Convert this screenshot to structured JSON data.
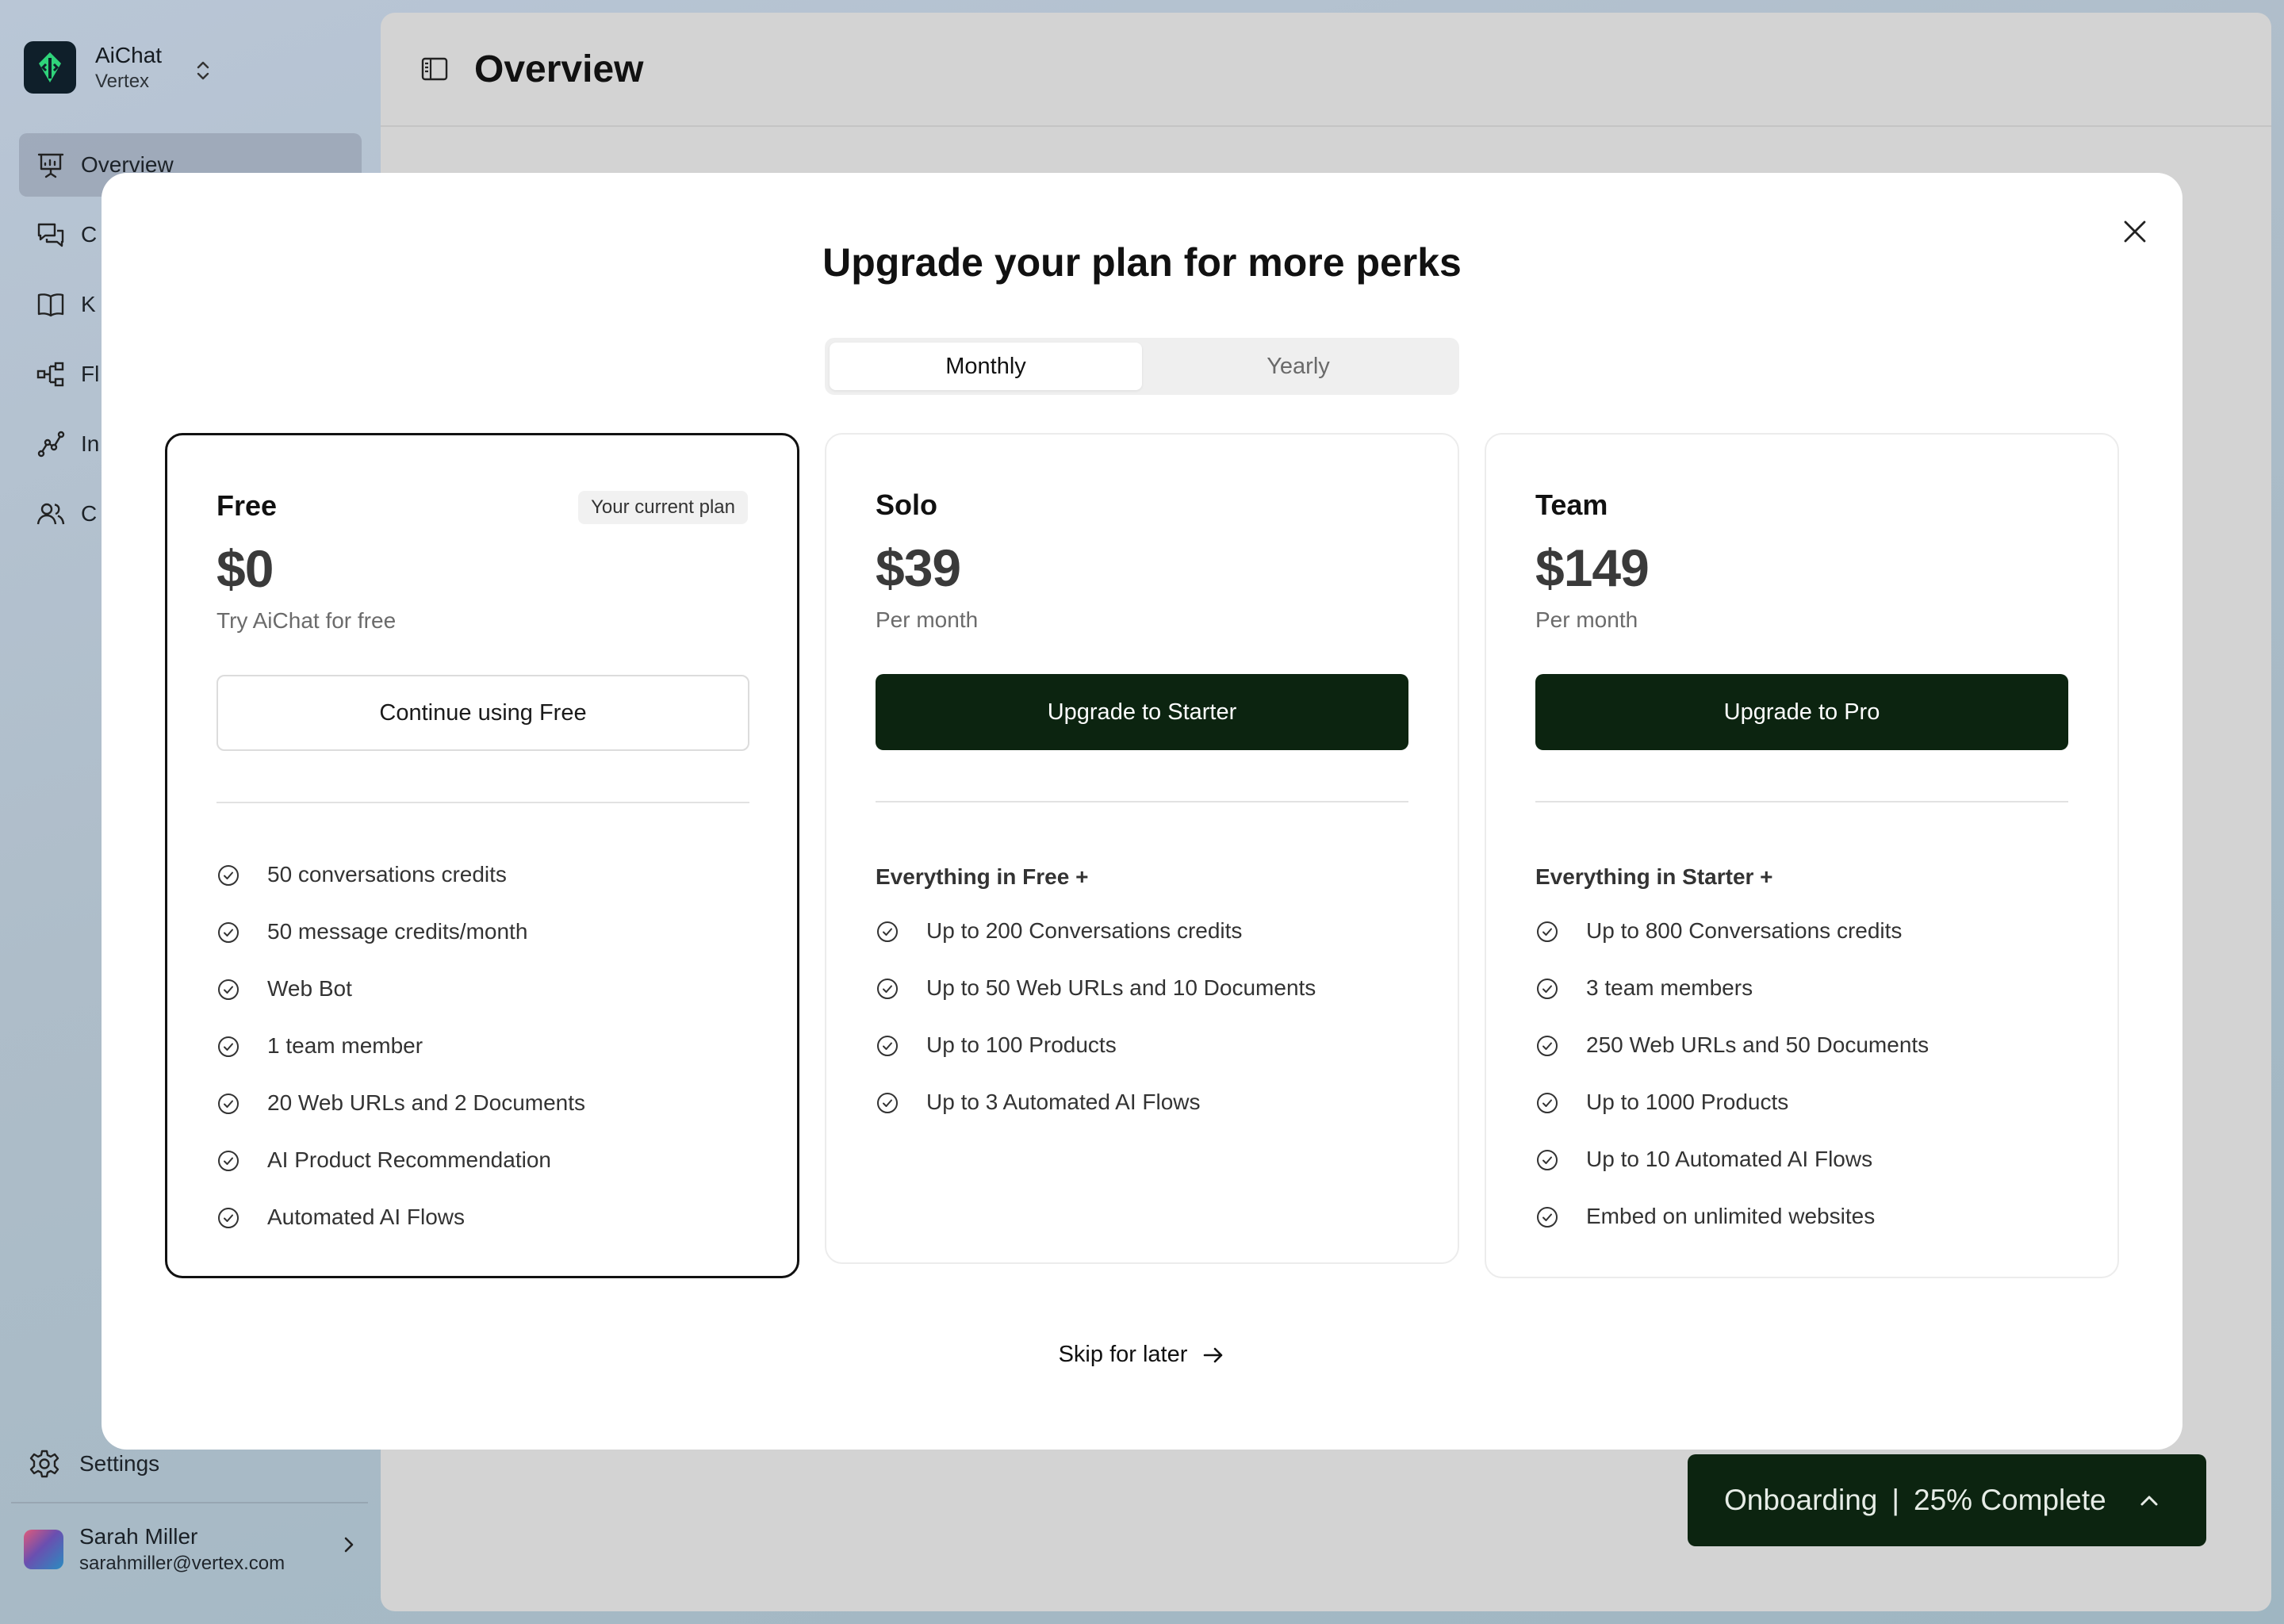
{
  "app": {
    "name": "AiChat",
    "workspace": "Vertex"
  },
  "sidebar": {
    "items": [
      {
        "label": "Overview",
        "icon": "presentation-icon",
        "active": true
      },
      {
        "label": "C",
        "icon": "chat-icon"
      },
      {
        "label": "K",
        "icon": "book-icon"
      },
      {
        "label": "Fl",
        "icon": "flow-icon"
      },
      {
        "label": "In",
        "icon": "insights-icon"
      },
      {
        "label": "C",
        "icon": "users-icon"
      }
    ],
    "settings_label": "Settings",
    "user": {
      "name": "Sarah Miller",
      "email": "sarahmiller@vertex.com"
    }
  },
  "header": {
    "title": "Overview"
  },
  "modal": {
    "title": "Upgrade your plan for more perks",
    "billing_toggle": {
      "options": [
        "Monthly",
        "Yearly"
      ],
      "selected": "Monthly"
    },
    "plans": [
      {
        "name": "Free",
        "badge": "Your current plan",
        "price": "$0",
        "subtitle": "Try AiChat for free",
        "cta": "Continue using Free",
        "features_heading": "",
        "features": [
          "50 conversations credits",
          "50 message credits/month",
          "Web Bot",
          "1 team member",
          "20 Web URLs and 2 Documents",
          "AI Product Recommendation",
          "Automated AI Flows"
        ]
      },
      {
        "name": "Solo",
        "price": "$39",
        "subtitle": "Per month",
        "cta": "Upgrade to Starter",
        "features_heading": "Everything in Free +",
        "features": [
          "Up to 200 Conversations credits",
          "Up to 50 Web URLs and 10 Documents",
          "Up to 100 Products",
          "Up to 3 Automated AI Flows"
        ]
      },
      {
        "name": "Team",
        "price": "$149",
        "subtitle": "Per month",
        "cta": "Upgrade to Pro",
        "features_heading": "Everything in Starter +",
        "features": [
          "Up to 800 Conversations credits",
          "3 team members",
          "250 Web URLs and 50 Documents",
          "Up to 1000 Products",
          "Up to 10 Automated AI Flows",
          "Embed on unlimited websites"
        ]
      }
    ],
    "skip_label": "Skip for later"
  },
  "onboarding": {
    "label": "Onboarding",
    "separator": "|",
    "progress_text": "25% Complete",
    "progress_percent": 25
  },
  "colors": {
    "accent_dark_green": "#0c2410",
    "brand_green": "#2fd47a"
  }
}
